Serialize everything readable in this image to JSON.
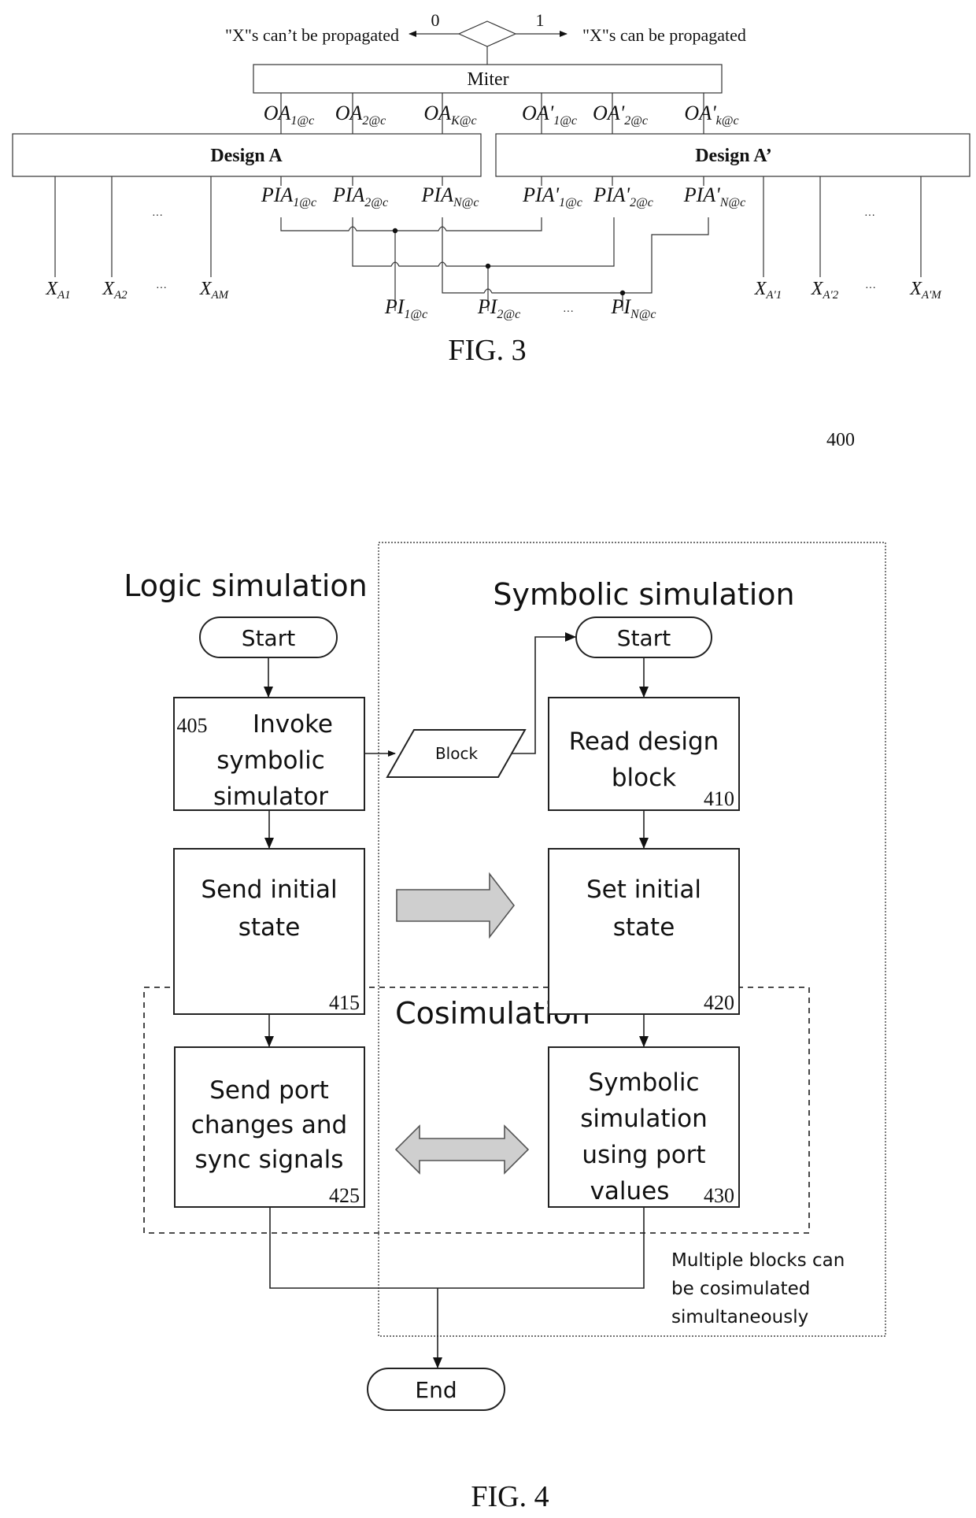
{
  "fig3": {
    "caption": "FIG. 3",
    "decision": {
      "left_label": "\"X\"s can’t be propagated",
      "right_label": "\"X\"s can be propagated",
      "left_value": "0",
      "right_value": "1"
    },
    "miter_label": "Miter",
    "design_a": {
      "title": "Design A",
      "outputs": [
        {
          "base": "OA",
          "sub": "1@c"
        },
        {
          "base": "OA",
          "sub": "2@c"
        },
        {
          "base": "OA",
          "sub": "K@c"
        }
      ],
      "inputs": [
        {
          "base": "PIA",
          "sub": "1@c"
        },
        {
          "base": "PIA",
          "sub": "2@c"
        },
        {
          "base": "PIA",
          "sub": "N@c"
        }
      ],
      "x_inputs": [
        {
          "base": "X",
          "sub": "A1"
        },
        {
          "base": "X",
          "sub": "A2"
        },
        {
          "base": "X",
          "sub": "AM"
        }
      ]
    },
    "design_a_prime": {
      "title": "Design A’",
      "outputs": [
        {
          "base": "OA'",
          "sub": "1@c"
        },
        {
          "base": "OA'",
          "sub": "2@c"
        },
        {
          "base": "OA'",
          "sub": "k@c"
        }
      ],
      "inputs": [
        {
          "base": "PIA'",
          "sub": "1@c"
        },
        {
          "base": "PIA'",
          "sub": "2@c"
        },
        {
          "base": "PIA'",
          "sub": "N@c"
        }
      ],
      "x_inputs": [
        {
          "base": "X",
          "sub": "A'1"
        },
        {
          "base": "X",
          "sub": "A'2"
        },
        {
          "base": "X",
          "sub": "A'M"
        }
      ]
    },
    "primary_inputs": [
      {
        "base": "PI",
        "sub": "1@c"
      },
      {
        "base": "PI",
        "sub": "2@c"
      },
      {
        "base": "PI",
        "sub": "N@c"
      }
    ],
    "ellipsis": "···"
  },
  "fig4": {
    "reference_number": "400",
    "caption": "FIG. 4",
    "regions": {
      "logic": "Logic simulation",
      "symbolic": "Symbolic simulation",
      "cosim": "Cosimulation"
    },
    "logic_start": "Start",
    "symbolic_start": "Start",
    "end": "End",
    "data_block": "Block",
    "steps": [
      {
        "id": "405",
        "lines": [
          "Invoke",
          "symbolic",
          "simulator"
        ]
      },
      {
        "id": "410",
        "lines": [
          "Read design",
          "block"
        ]
      },
      {
        "id": "415",
        "lines": [
          "Send initial",
          "state"
        ]
      },
      {
        "id": "420",
        "lines": [
          "Set initial",
          "state"
        ]
      },
      {
        "id": "425",
        "lines": [
          "Send port",
          "changes and",
          "sync signals"
        ]
      },
      {
        "id": "430",
        "lines": [
          "Symbolic",
          "simulation",
          "using port",
          "values"
        ]
      }
    ],
    "note_lines": [
      "Multiple blocks can",
      "be  cosimulated",
      "simultaneously"
    ]
  }
}
